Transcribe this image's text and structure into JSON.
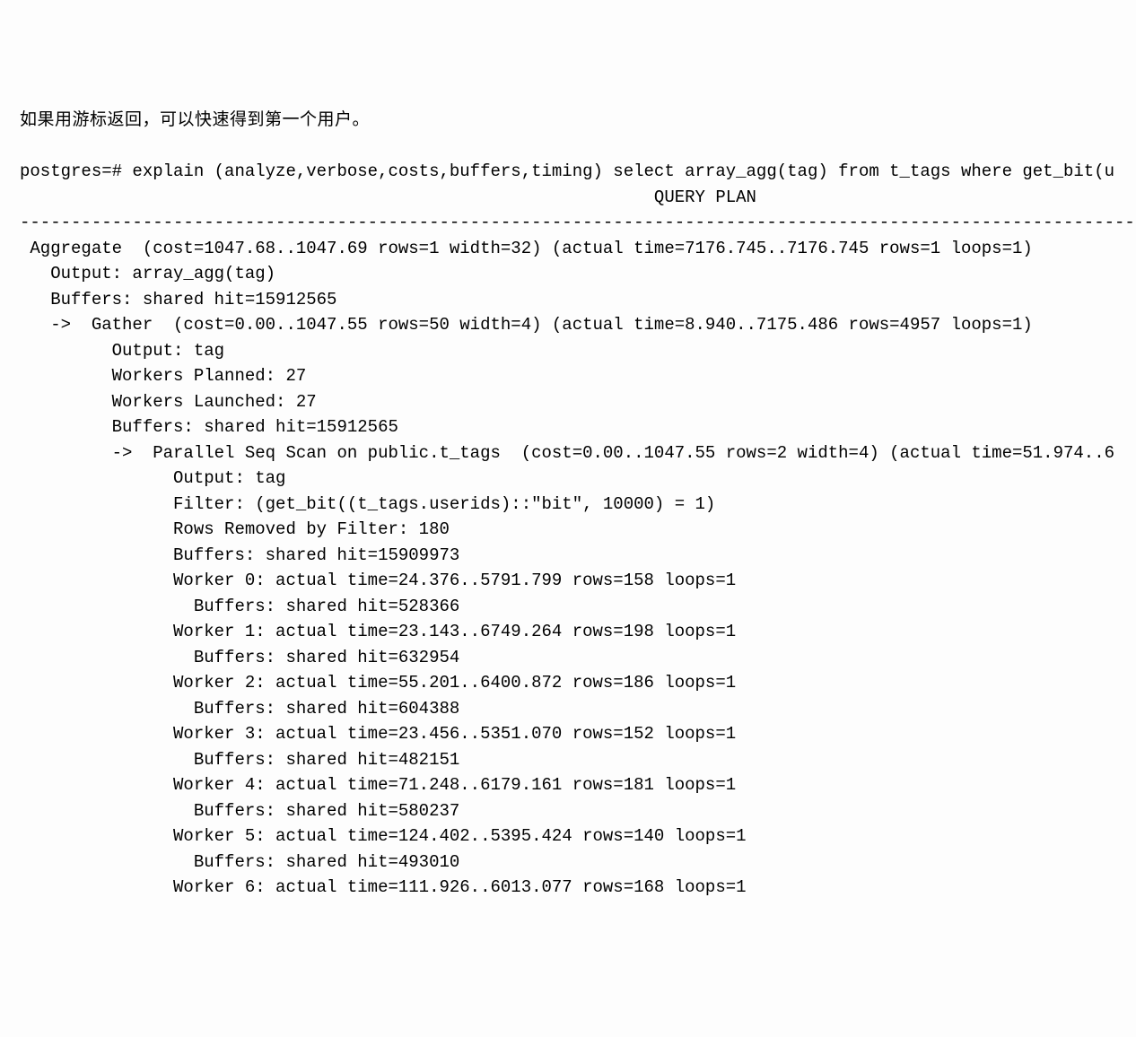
{
  "intro_text": "如果用游标返回，可以快速得到第一个用户。",
  "prompt_line": "postgres=# explain (analyze,verbose,costs,buffers,timing) select array_agg(tag) from t_tags where get_bit(u",
  "query_plan_header": "                                                              QUERY PLAN",
  "separator": "-------------------------------------------------------------------------------------------------------------",
  "plan_lines": [
    " Aggregate  (cost=1047.68..1047.69 rows=1 width=32) (actual time=7176.745..7176.745 rows=1 loops=1)",
    "   Output: array_agg(tag)",
    "   Buffers: shared hit=15912565",
    "   ->  Gather  (cost=0.00..1047.55 rows=50 width=4) (actual time=8.940..7175.486 rows=4957 loops=1)",
    "         Output: tag",
    "         Workers Planned: 27",
    "         Workers Launched: 27",
    "         Buffers: shared hit=15912565",
    "         ->  Parallel Seq Scan on public.t_tags  (cost=0.00..1047.55 rows=2 width=4) (actual time=51.974..6",
    "               Output: tag",
    "               Filter: (get_bit((t_tags.userids)::\"bit\", 10000) = 1)",
    "               Rows Removed by Filter: 180",
    "               Buffers: shared hit=15909973",
    "               Worker 0: actual time=24.376..5791.799 rows=158 loops=1",
    "                 Buffers: shared hit=528366",
    "               Worker 1: actual time=23.143..6749.264 rows=198 loops=1",
    "                 Buffers: shared hit=632954",
    "               Worker 2: actual time=55.201..6400.872 rows=186 loops=1",
    "                 Buffers: shared hit=604388",
    "               Worker 3: actual time=23.456..5351.070 rows=152 loops=1",
    "                 Buffers: shared hit=482151",
    "               Worker 4: actual time=71.248..6179.161 rows=181 loops=1",
    "                 Buffers: shared hit=580237",
    "               Worker 5: actual time=124.402..5395.424 rows=140 loops=1",
    "                 Buffers: shared hit=493010",
    "               Worker 6: actual time=111.926..6013.077 rows=168 loops=1"
  ]
}
